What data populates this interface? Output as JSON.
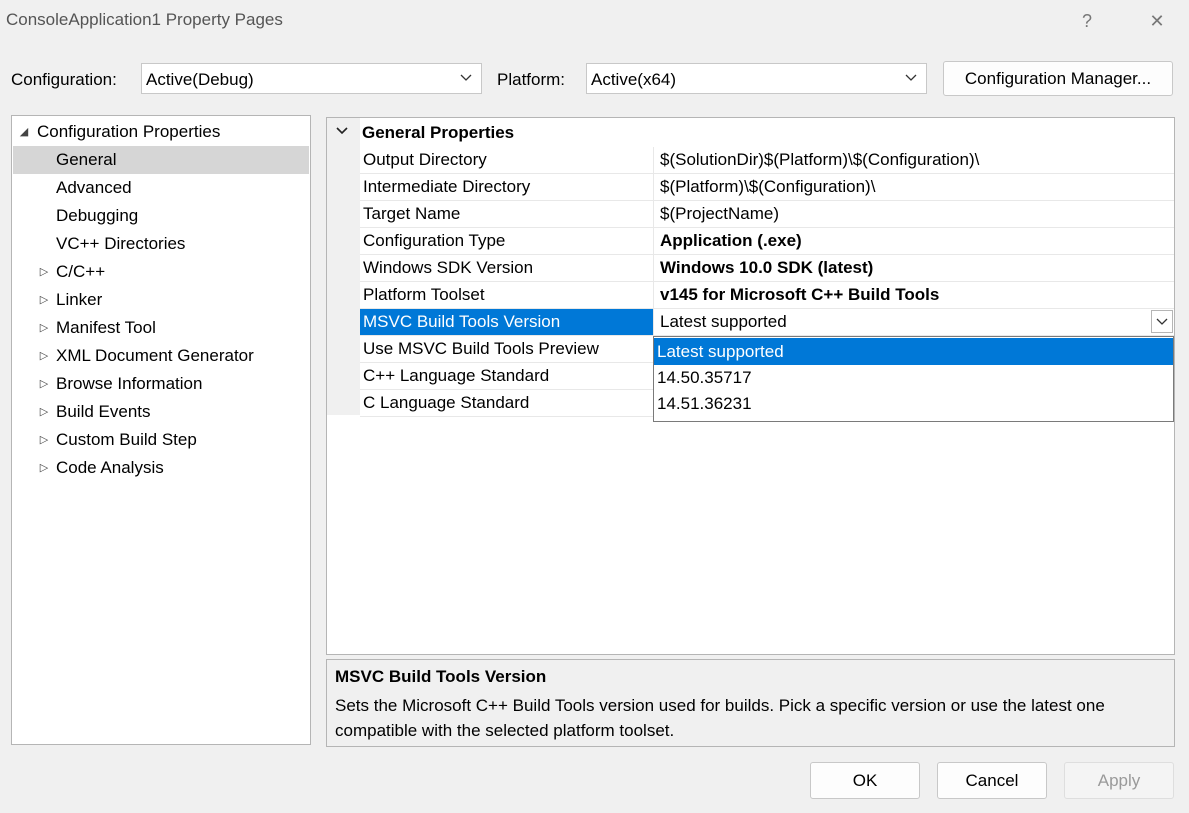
{
  "window": {
    "title": "ConsoleApplication1 Property Pages",
    "help": "?",
    "close": "✕"
  },
  "config_label": "Configuration:",
  "config_value": "Active(Debug)",
  "platform_label": "Platform:",
  "platform_value": "Active(x64)",
  "config_manager_label": "Configuration Manager...",
  "tree": {
    "root": "Configuration Properties",
    "items": [
      "General",
      "Advanced",
      "Debugging",
      "VC++ Directories"
    ],
    "expandable": [
      "C/C++",
      "Linker",
      "Manifest Tool",
      "XML Document Generator",
      "Browse Information",
      "Build Events",
      "Custom Build Step",
      "Code Analysis"
    ]
  },
  "grid": {
    "category": "General Properties",
    "rows": [
      {
        "name": "Output Directory",
        "value": "$(SolutionDir)$(Platform)\\$(Configuration)\\"
      },
      {
        "name": "Intermediate Directory",
        "value": "$(Platform)\\$(Configuration)\\"
      },
      {
        "name": "Target Name",
        "value": "$(ProjectName)"
      },
      {
        "name": "Configuration Type",
        "value": "Application (.exe)"
      },
      {
        "name": "Windows SDK Version",
        "value": "Windows 10.0 SDK (latest)"
      },
      {
        "name": "Platform Toolset",
        "value": "v145 for Microsoft C++ Build Tools"
      },
      {
        "name": "MSVC Build Tools Version",
        "value": "Latest supported"
      },
      {
        "name": "Use MSVC Build Tools Preview",
        "value": ""
      },
      {
        "name": "C++ Language Standard",
        "value": ""
      },
      {
        "name": "C Language Standard",
        "value": ""
      }
    ]
  },
  "dropdown_options": [
    "Latest supported",
    "14.50.35717",
    "14.51.36231"
  ],
  "description": {
    "heading": "MSVC Build Tools Version",
    "text": "Sets the Microsoft C++ Build Tools version used for builds. Pick a specific version or use the latest one compatible with the selected platform toolset."
  },
  "buttons": {
    "ok": "OK",
    "cancel": "Cancel",
    "apply": "Apply"
  },
  "colors": {
    "selection": "#0078d7",
    "tree_selection": "#d6d6d6",
    "background": "#f0f0f0"
  }
}
